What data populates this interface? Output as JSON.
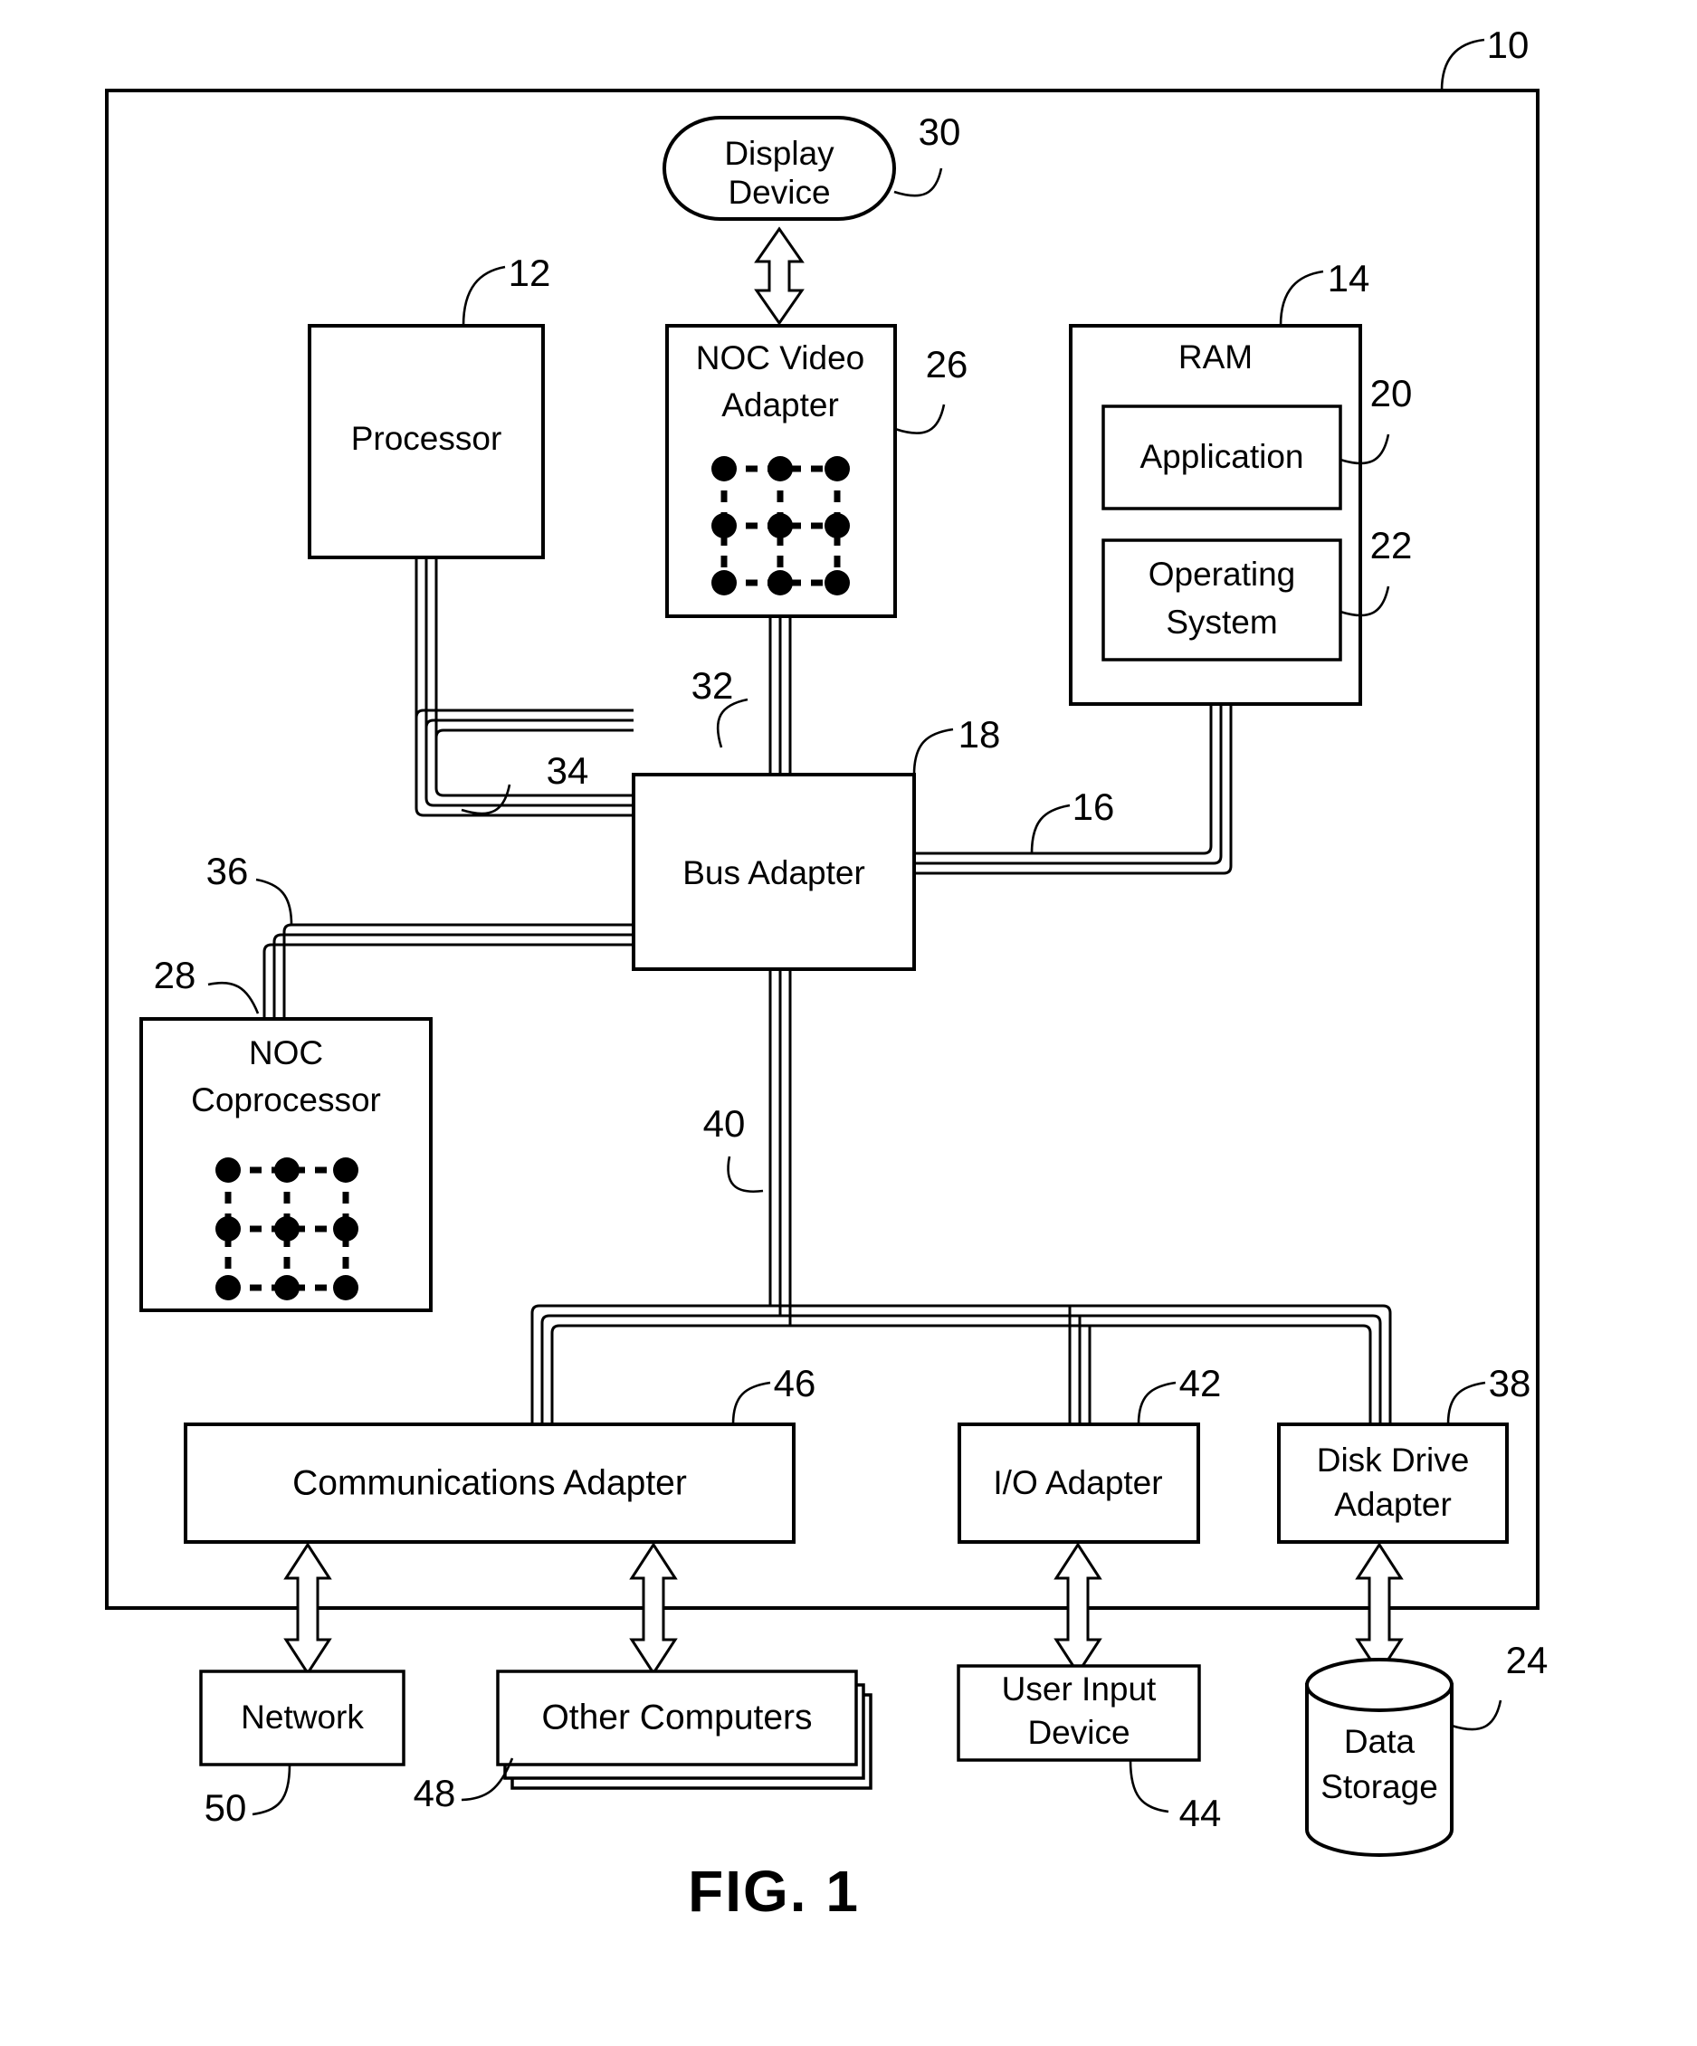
{
  "figure": {
    "caption": "FIG. 1",
    "outer_ref": "10"
  },
  "nodes": {
    "display_device": {
      "label_line1": "Display",
      "label_line2": "Device",
      "ref": "30"
    },
    "processor": {
      "label": "Processor",
      "ref": "12"
    },
    "noc_video_adapter": {
      "label_line1": "NOC Video",
      "label_line2": "Adapter",
      "ref": "26"
    },
    "ram": {
      "label": "RAM",
      "ref": "14"
    },
    "application": {
      "label": "Application",
      "ref": "20"
    },
    "operating_system": {
      "label_line1": "Operating",
      "label_line2": "System",
      "ref": "22"
    },
    "bus_adapter": {
      "label": "Bus Adapter",
      "ref": "18"
    },
    "noc_coprocessor": {
      "label_line1": "NOC",
      "label_line2": "Coprocessor",
      "ref": "28"
    },
    "communications_adapter": {
      "label": "Communications Adapter",
      "ref": "46"
    },
    "io_adapter": {
      "label": "I/O Adapter",
      "ref": "42"
    },
    "disk_drive_adapter": {
      "label_line1": "Disk Drive",
      "label_line2": "Adapter",
      "ref": "38"
    },
    "network": {
      "label": "Network",
      "ref": "50"
    },
    "other_computers": {
      "label": "Other Computers",
      "ref": "48"
    },
    "user_input_device": {
      "label_line1": "User Input",
      "label_line2": "Device",
      "ref": "44"
    },
    "data_storage": {
      "label_line1": "Data",
      "label_line2": "Storage",
      "ref": "24"
    }
  },
  "buses": {
    "front_side_bus_processor": {
      "ref": "34"
    },
    "video_bus": {
      "ref": "32"
    },
    "memory_bus": {
      "ref": "16"
    },
    "coprocessor_bus": {
      "ref": "36"
    },
    "expansion_bus": {
      "ref": "40"
    }
  },
  "colors": {
    "stroke": "#000000",
    "fill": "#ffffff"
  }
}
